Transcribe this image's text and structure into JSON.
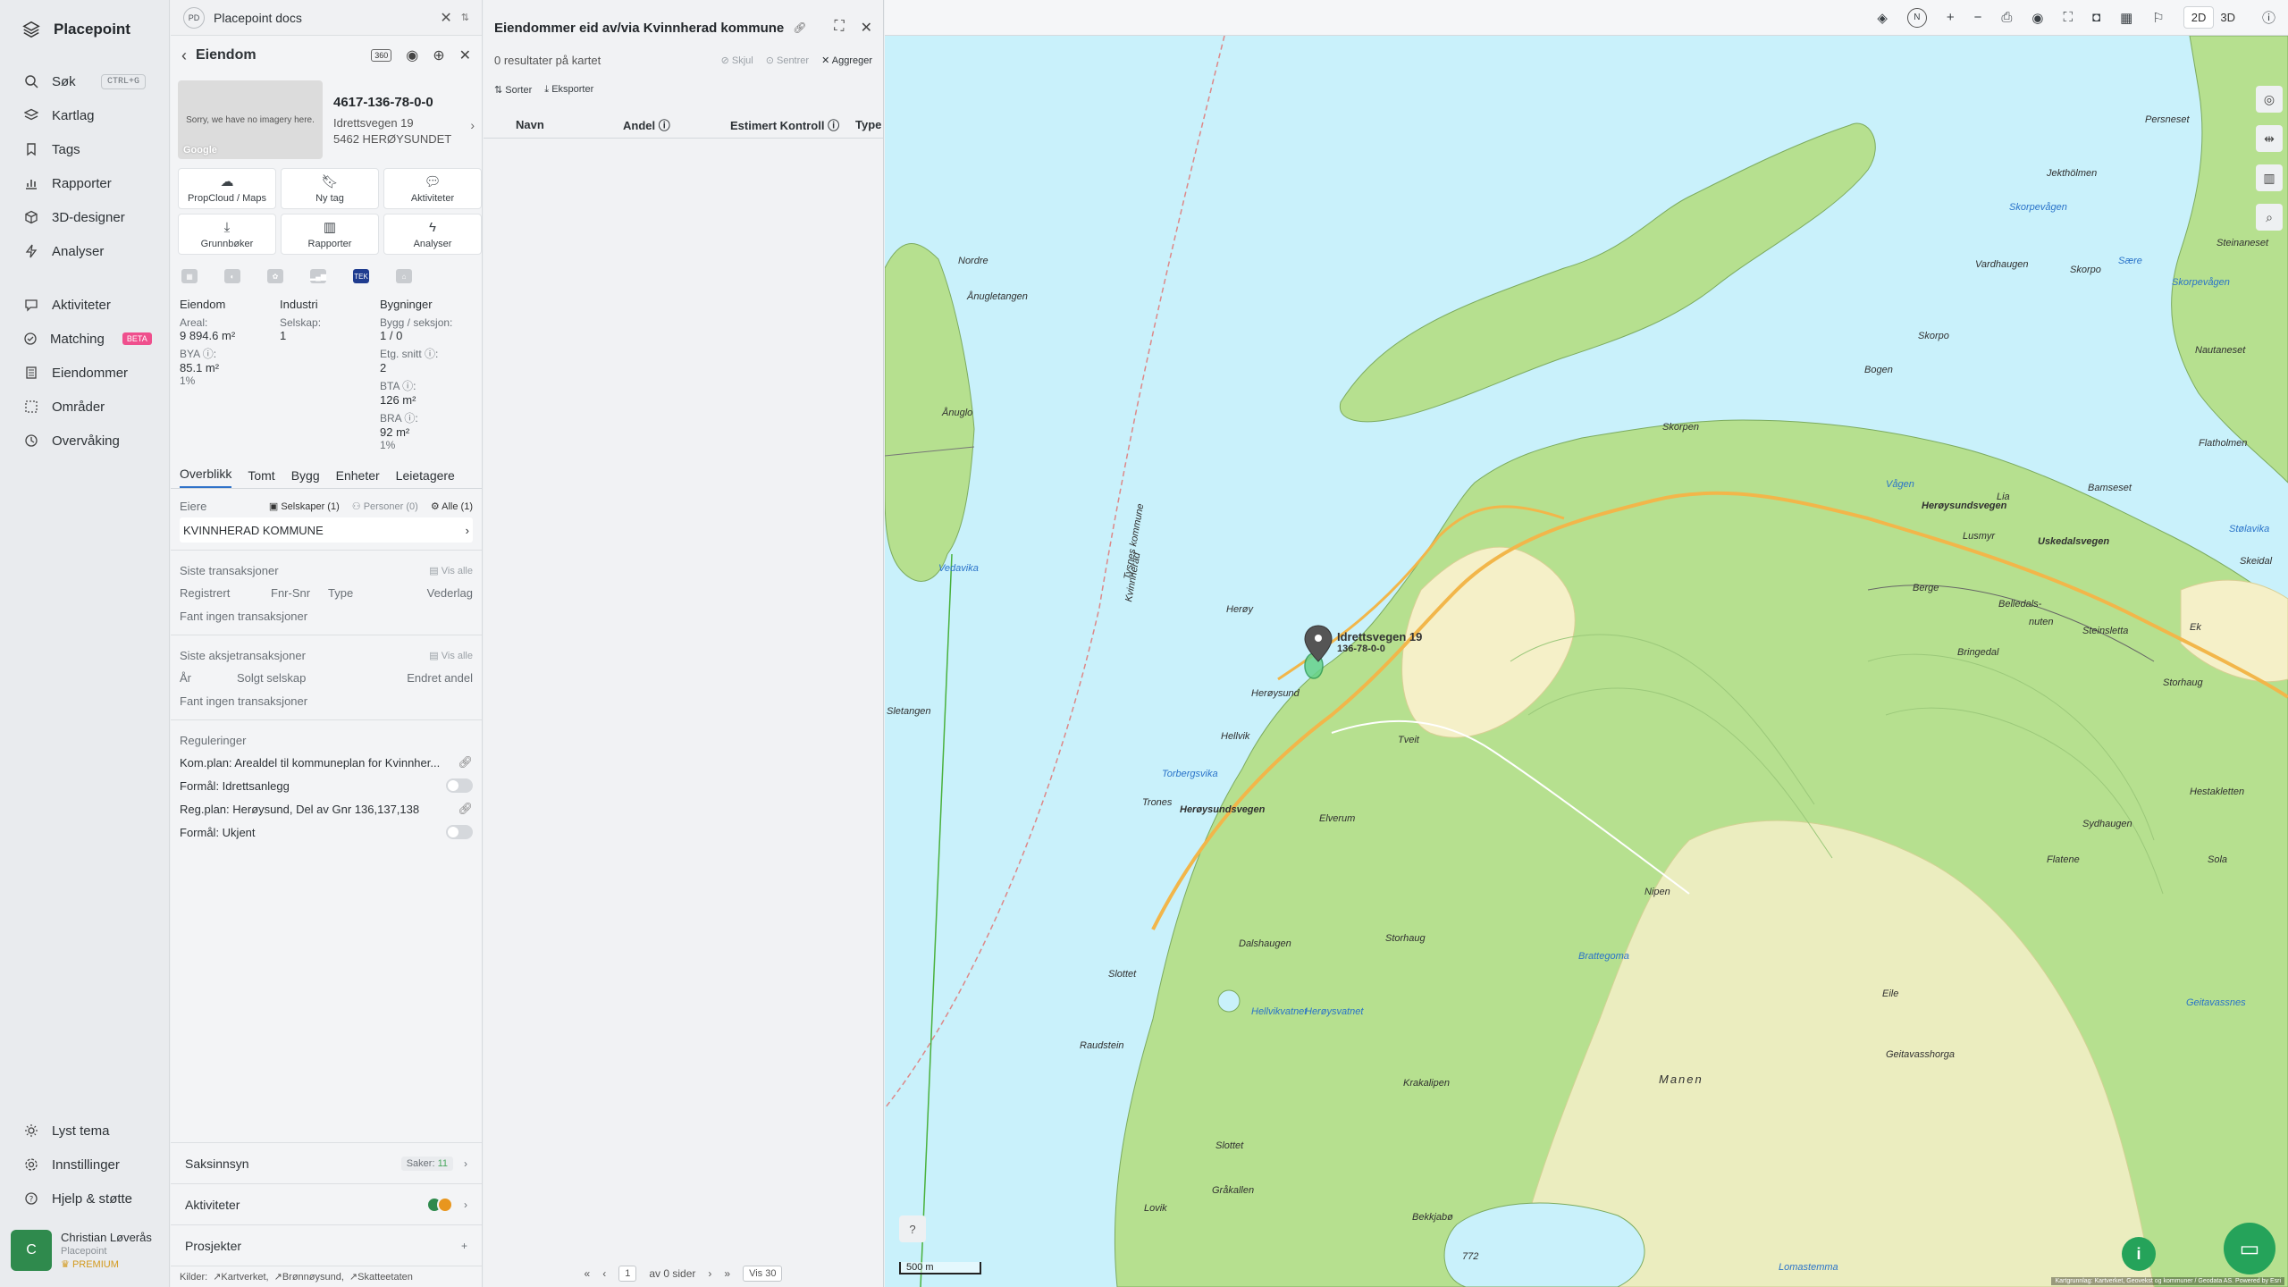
{
  "app": {
    "name": "Placepoint"
  },
  "nav": {
    "items": [
      {
        "label": "Søk",
        "kbd": "CTRL+G",
        "icon": "search-icon"
      },
      {
        "label": "Kartlag",
        "icon": "layers-icon"
      },
      {
        "label": "Tags",
        "icon": "bookmark-icon"
      },
      {
        "label": "Rapporter",
        "icon": "chart-icon"
      },
      {
        "label": "3D-designer",
        "icon": "cube-icon"
      },
      {
        "label": "Analyser",
        "icon": "bolt-icon"
      }
    ],
    "items2": [
      {
        "label": "Aktiviteter",
        "icon": "chat-icon"
      },
      {
        "label": "Matching",
        "badge": "BETA",
        "icon": "matching-icon"
      },
      {
        "label": "Eiendommer",
        "icon": "building-icon"
      },
      {
        "label": "Områder",
        "icon": "area-icon"
      },
      {
        "label": "Overvåking",
        "icon": "monitor-icon"
      }
    ],
    "bottom": [
      {
        "label": "Lyst tema",
        "icon": "sun-icon"
      },
      {
        "label": "Innstillinger",
        "icon": "gear-icon"
      },
      {
        "label": "Hjelp & støtte",
        "icon": "help-icon"
      }
    ],
    "user": {
      "initial": "C",
      "name": "Christian Løverås",
      "org": "Placepoint",
      "plan": "PREMIUM"
    }
  },
  "docs": {
    "badge": "PD",
    "title": "Placepoint docs"
  },
  "property": {
    "header": "Eiendom",
    "badge360": "360",
    "thumb_text": "Sorry, we have no imagery here.",
    "thumb_brand": "Google",
    "id": "4617-136-78-0-0",
    "address1": "Idrettsvegen 19",
    "address2": "5462 HERØYSUNDET",
    "actions": [
      {
        "label": "PropCloud / Maps",
        "icon": "cloud-icon"
      },
      {
        "label": "Ny tag",
        "icon": "bookmark-icon"
      },
      {
        "label": "Aktiviteter",
        "icon": "chat-icon"
      },
      {
        "label": "Grunnbøker",
        "icon": "download-icon"
      },
      {
        "label": "Rapporter",
        "icon": "chart-icon"
      },
      {
        "label": "Analyser",
        "icon": "bolt-icon"
      }
    ],
    "tek_label": "TEK",
    "facts": {
      "c1": {
        "h": "Eiendom",
        "areal_l": "Areal:",
        "areal_v": "9 894.6 m²",
        "bya_l": "BYA ⓘ:",
        "bya_v": "85.1 m²",
        "bya_p": "1%"
      },
      "c2": {
        "h": "Industri",
        "selskap_l": "Selskap:",
        "selskap_v": "1"
      },
      "c3": {
        "h": "Bygninger",
        "bygg_l": "Bygg / seksjon:",
        "bygg_v": "1 / 0",
        "etg_l": "Etg. snitt ⓘ:",
        "etg_v": "2",
        "bta_l": "BTA ⓘ:",
        "bta_v": "126 m²",
        "bra_l": "BRA ⓘ:",
        "bra_v": "92 m²",
        "bra_p": "1%"
      }
    },
    "tabs": [
      "Overblikk",
      "Tomt",
      "Bygg",
      "Enheter",
      "Leietagere"
    ],
    "owners": {
      "title": "Eiere",
      "f1": "Selskaper (1)",
      "f2": "Personer (0)",
      "f3": "Alle (1)",
      "owner": "KVINNHERAD KOMMUNE"
    },
    "tx": {
      "title": "Siste transaksjoner",
      "vis": "Vis alle",
      "cols": [
        "Registrert",
        "Fnr-Snr",
        "Type",
        "Vederlag"
      ],
      "empty": "Fant ingen transaksjoner"
    },
    "stx": {
      "title": "Siste aksjetransaksjoner",
      "vis": "Vis alle",
      "cols": [
        "År",
        "Solgt selskap",
        "Endret andel"
      ],
      "empty": "Fant ingen transaksjoner"
    },
    "reg": {
      "title": "Reguleringer",
      "r1": "Kom.plan: Arealdel til kommuneplan for Kvinnher...",
      "r1f": "Formål: Idrettsanlegg",
      "r2": "Reg.plan: Herøysund, Del av Gnr 136,137,138",
      "r2f": "Formål: Ukjent"
    },
    "footer": {
      "saksinnsyn": "Saksinnsyn",
      "saker_l": "Saker:",
      "saker_v": "11",
      "aktiviteter": "Aktiviteter",
      "prosjekter": "Prosjekter",
      "plus": "+",
      "kilder": "Kilder:",
      "k1": "Kartverket,",
      "k2": "Brønnøysund,",
      "k3": "Skatteetaten"
    }
  },
  "results": {
    "title": "Eiendommer eid av/via Kvinnherad kommune",
    "count": "0 resultater på kartet",
    "skjul": "Skjul",
    "sentrer": "Sentrer",
    "aggreger": "Aggreger",
    "sorter": "Sorter",
    "eksporter": "Eksporter",
    "cols": [
      "Navn",
      "Andel ⓘ",
      "Estimert Kontroll ⓘ",
      "Type"
    ],
    "pager": {
      "page": "1",
      "of": "av 0 sider",
      "vis": "Vis 30"
    }
  },
  "map": {
    "view2d": "2D",
    "view3d": "3D",
    "compass": "N",
    "pin": "Idrettsvegen 19",
    "pin2": "136-78-0-0",
    "scale": "500 m",
    "attrib": "Kartgrunnlag: Kartverket, Geovekst og kommuner / Geodata AS. Powered by Esri",
    "colors": {
      "water": "#c9f1fb",
      "land": "#f5f0c8",
      "forest": "#b6e08f",
      "road": "#f2b64a",
      "accent": "#25a35a"
    },
    "places": [
      "Nordre",
      "Ånugletangen",
      "Ånuglo",
      "Vedavika",
      "Persneset",
      "Jekthölmen",
      "Skorpevågen",
      "Sære",
      "Skorpevågen",
      "Steinaneset",
      "Vardhaugen",
      "Skorpo",
      "Skorpo",
      "Nautaneset",
      "Bogen",
      "Skorpen",
      "Flatholmen",
      "Vågen",
      "Lia",
      "Bamseset",
      "Stølavika",
      "Skeidal",
      "Herøysundsvegen",
      "Uskedalsvegen",
      "Lusmyr",
      "Berge",
      "Belledals-",
      "nuten",
      "Bringedal",
      "Steinsletta",
      "Ek",
      "Storhaug",
      "Herøy",
      "Herøysund",
      "Hellvik",
      "Torbergsvika",
      "Tveit",
      "Trones",
      "Herøysundsvegen",
      "Elverum",
      "Hestakletten",
      "Sydhaugen",
      "Flatene",
      "Sola",
      "Nipen",
      "Dalshaugen",
      "Storhaug",
      "Brattegoma",
      "Eile",
      "Slottet",
      "Hellvikvatnet",
      "Geitavassnes",
      "Raudstein",
      "Geitavasshorga",
      "Manen",
      "Krakalipen",
      "Slottet",
      "Gråkallen",
      "Lovik",
      "Bekkjabø",
      "Lomastemma",
      "Sletangen",
      "Tysnes kommune",
      "Kvinnherad",
      "772",
      "Herøysvatnet"
    ]
  }
}
